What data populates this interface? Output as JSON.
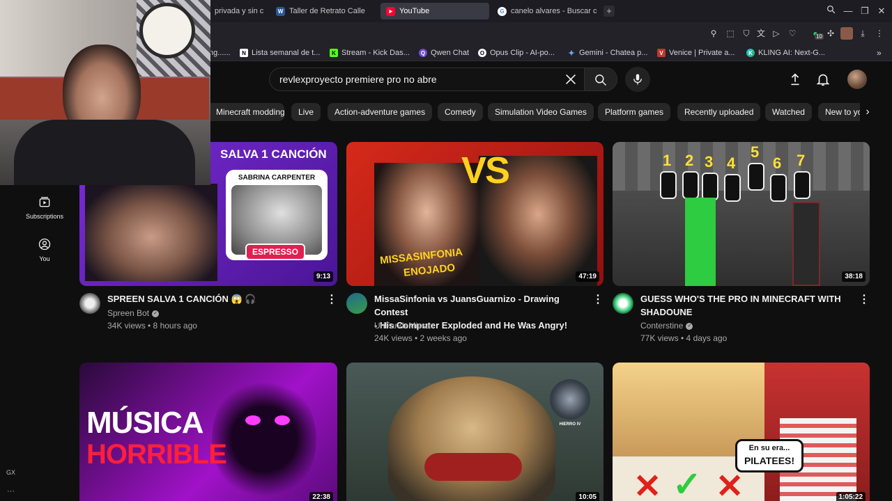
{
  "tabs": [
    {
      "label": "privada y sin c",
      "icon": "privacy-tab-icon"
    },
    {
      "label": "Taller de Retrato Calle",
      "icon": "word-icon"
    },
    {
      "label": "YouTube",
      "icon": "youtube-icon"
    },
    {
      "label": "canelo alvares - Buscar c",
      "icon": "google-icon"
    }
  ],
  "bookmarks": [
    {
      "label": "ng......",
      "icon": ""
    },
    {
      "label": "Lista semanal de t...",
      "icon": "notion-icon"
    },
    {
      "label": "Stream - Kick Das...",
      "icon": "kick-icon"
    },
    {
      "label": "Qwen Chat",
      "icon": "qwen-icon"
    },
    {
      "label": "Opus Clip - AI-po...",
      "icon": "opus-icon"
    },
    {
      "label": "Gemini - Chatea p...",
      "icon": "gemini-icon"
    },
    {
      "label": "Venice | Private a...",
      "icon": "venice-icon"
    },
    {
      "label": "KLING AI: Next-G...",
      "icon": "kling-icon"
    }
  ],
  "extension_badge": "10",
  "search": {
    "value": "revlexproyecto premiere pro no abre"
  },
  "chips": [
    "Minecraft modding",
    "Live",
    "Action-adventure games",
    "Comedy",
    "Simulation Video Games",
    "Platform games",
    "Recently uploaded",
    "Watched",
    "New to yo"
  ],
  "sidebar": {
    "items": [
      {
        "label": "Subscriptions",
        "icon": "subscriptions-icon"
      },
      {
        "label": "You",
        "icon": "you-icon"
      }
    ],
    "gx_label": "GX",
    "more": "···"
  },
  "videos": [
    {
      "title_line1": "SPREEN SALVA 1 CANCIÓN 😱 🎧",
      "title_line2": "",
      "channel": "Spreen Bot",
      "verified": true,
      "meta": "34K views • 8 hours ago",
      "duration": "9:13",
      "overlay": [
        "SALVA 1 CANCIÓN",
        "SABRINA CARPENTER",
        "ESPRESSO"
      ]
    },
    {
      "title_line1": "MissaSinfonia vs JuansGuarnizo - Drawing Contest",
      "title_line2": "- His Computer Exploded and He Was Angry!",
      "channel": "UnFandeMissa",
      "verified": false,
      "meta": "24K views • 2 weeks ago",
      "duration": "47:19",
      "overlay": [
        "VS",
        "MISSASINFONIA",
        "ENOJADO"
      ]
    },
    {
      "title_line1": "GUESS WHO'S THE PRO IN MINECRAFT WITH",
      "title_line2": "SHADOUNE",
      "channel": "Conterstine",
      "verified": true,
      "meta": "77K views • 4 days ago",
      "duration": "38:18",
      "overlay": [
        "1",
        "2",
        "3",
        "4",
        "5",
        "6",
        "7"
      ]
    },
    {
      "duration": "22:38",
      "overlay": [
        "MÚSICA",
        "HORRIBLE"
      ]
    },
    {
      "duration": "10:05",
      "overlay": [
        "HIERRO IV"
      ]
    },
    {
      "duration": "1:05:22",
      "overlay": [
        "En su era...",
        "PILATEES!"
      ]
    }
  ],
  "colors": {
    "bg": "#0f0f0f",
    "chip": "#272727",
    "youtube_red": "#ff0033",
    "meta": "#aaaaaa"
  }
}
